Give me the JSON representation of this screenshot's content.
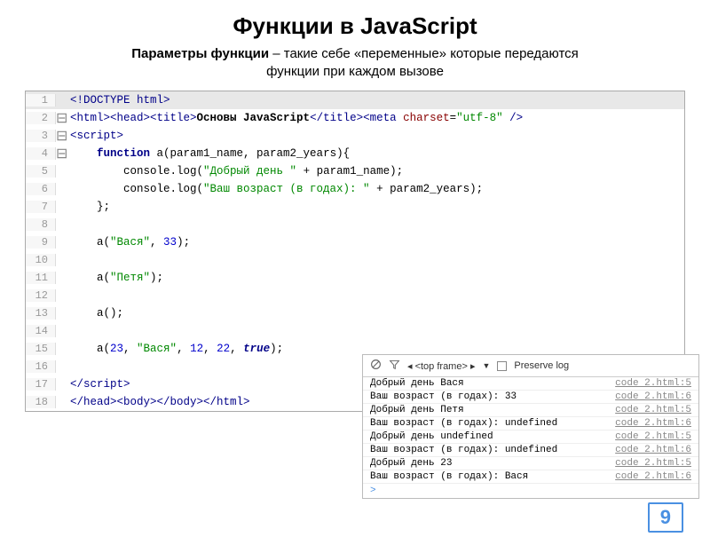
{
  "title": "Функции в JavaScript",
  "subtitle_bold": "Параметры функции",
  "subtitle_rest": " – такие себе «переменные» которые передаются функции при каждом вызове",
  "code_lines": [
    {
      "n": "1",
      "fold": "",
      "html": "<span class='tag'>&lt;!DOCTYPE html&gt;</span>"
    },
    {
      "n": "2",
      "fold": "⊟",
      "html": "<span class='tag'>&lt;html&gt;&lt;head&gt;&lt;title&gt;</span><b>Основы JavaScript</b><span class='tag'>&lt;/title&gt;&lt;meta</span> <span class='attr'>charset</span>=<span class='str'>\"utf-8\"</span> <span class='tag'>/&gt;</span>"
    },
    {
      "n": "3",
      "fold": "⊟",
      "html": "<span class='tag'>&lt;script&gt;</span>"
    },
    {
      "n": "4",
      "fold": "⊟",
      "html": "    <span class='kw'>function</span> a(param1_name, param2_years){"
    },
    {
      "n": "5",
      "fold": "",
      "html": "        console.log(<span class='str'>\"Добрый день \"</span> + param1_name);"
    },
    {
      "n": "6",
      "fold": "",
      "html": "        console.log(<span class='str'>\"Ваш возраст (в годах): \"</span> + param2_years);"
    },
    {
      "n": "7",
      "fold": "",
      "html": "    };"
    },
    {
      "n": "8",
      "fold": "",
      "html": ""
    },
    {
      "n": "9",
      "fold": "",
      "html": "    a(<span class='str'>\"Вася\"</span>, <span class='num'>33</span>);"
    },
    {
      "n": "10",
      "fold": "",
      "html": ""
    },
    {
      "n": "11",
      "fold": "",
      "html": "    a(<span class='str'>\"Петя\"</span>);"
    },
    {
      "n": "12",
      "fold": "",
      "html": ""
    },
    {
      "n": "13",
      "fold": "",
      "html": "    a();"
    },
    {
      "n": "14",
      "fold": "",
      "html": ""
    },
    {
      "n": "15",
      "fold": "",
      "html": "    a(<span class='num'>23</span>, <span class='str'>\"Вася\"</span>, <span class='num'>12</span>, <span class='num'>22</span>, <span class='bool'>true</span>);"
    },
    {
      "n": "16",
      "fold": "",
      "html": ""
    },
    {
      "n": "17",
      "fold": "",
      "html": "<span class='tag'>&lt;/script&gt;</span>"
    },
    {
      "n": "18",
      "fold": "",
      "html": "<span class='tag'>&lt;/head&gt;&lt;body&gt;&lt;/body&gt;&lt;/html&gt;</span>"
    }
  ],
  "console": {
    "frame_label": "<top frame>",
    "preserve_label": "Preserve log",
    "rows": [
      {
        "msg": "Добрый день Вася",
        "src": "code 2.html:5"
      },
      {
        "msg": "Ваш возраст (в годах): 33",
        "src": "code 2.html:6"
      },
      {
        "msg": "Добрый день Петя",
        "src": "code 2.html:5"
      },
      {
        "msg": "Ваш возраст (в годах): undefined",
        "src": "code 2.html:6"
      },
      {
        "msg": "Добрый день undefined",
        "src": "code 2.html:5"
      },
      {
        "msg": "Ваш возраст (в годах): undefined",
        "src": "code 2.html:6"
      },
      {
        "msg": "Добрый день 23",
        "src": "code 2.html:5"
      },
      {
        "msg": "Ваш возраст (в годах): Вася",
        "src": "code 2.html:6"
      }
    ],
    "prompt": ">"
  },
  "page_number": "9"
}
